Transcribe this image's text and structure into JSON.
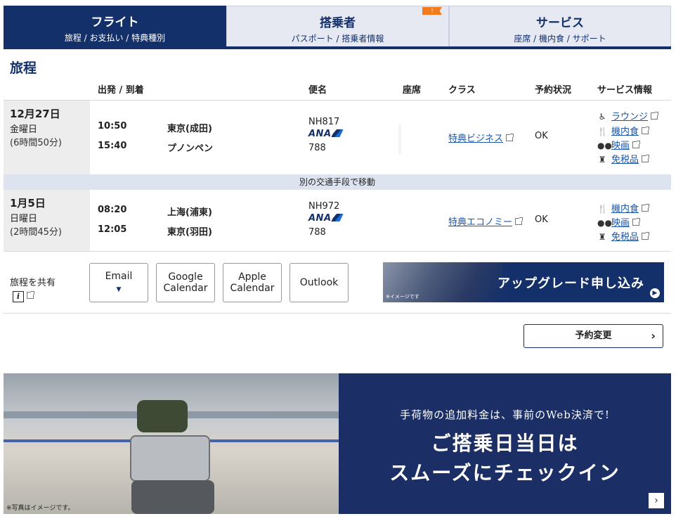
{
  "tabs": [
    {
      "title": "フライト",
      "sub": "旅程 / お支払い / 特典種別"
    },
    {
      "title": "搭乗者",
      "sub": "パスポート / 搭乗者情報"
    },
    {
      "title": "サービス",
      "sub": "座席 / 機内食 / サポート"
    }
  ],
  "section_title": "旅程",
  "headers": {
    "dep_arr": "出発 / 到着",
    "flight": "便名",
    "seat": "座席",
    "class": "クラス",
    "status": "予約状況",
    "service": "サービス情報"
  },
  "segments": [
    {
      "date": "12月27日",
      "weekday": "金曜日",
      "duration": "(6時間50分)",
      "dep_time": "10:50",
      "dep_city": "東京(成田)",
      "arr_time": "15:40",
      "arr_city": "プノンペン",
      "flight_no": "NH817",
      "airline": "ANA",
      "aircraft": "788",
      "class": "特典ビジネス",
      "status": "OK",
      "services": [
        {
          "icon": "lounge-icon",
          "label": "ラウンジ"
        },
        {
          "icon": "meal-icon",
          "label": "機内食"
        },
        {
          "icon": "movie-icon",
          "label": "映画"
        },
        {
          "icon": "duty-free-icon",
          "label": "免税品"
        }
      ]
    },
    {
      "date": "1月5日",
      "weekday": "日曜日",
      "duration": "(2時間45分)",
      "dep_time": "08:20",
      "dep_city": "上海(浦東)",
      "arr_time": "12:05",
      "arr_city": "東京(羽田)",
      "flight_no": "NH972",
      "airline": "ANA",
      "aircraft": "788",
      "class": "特典エコノミー",
      "status": "OK",
      "services": [
        {
          "icon": "meal-icon",
          "label": "機内食"
        },
        {
          "icon": "movie-icon",
          "label": "映画"
        },
        {
          "icon": "duty-free-icon",
          "label": "免税品"
        }
      ]
    }
  ],
  "transfer_note": "別の交通手段で移動",
  "share": {
    "label": "旅程を共有",
    "buttons": [
      {
        "line1": "Email",
        "line2": ""
      },
      {
        "line1": "Google",
        "line2": "Calendar"
      },
      {
        "line1": "Apple",
        "line2": "Calendar"
      },
      {
        "line1": "Outlook",
        "line2": ""
      }
    ]
  },
  "upgrade_banner": {
    "text": "アップグレード申し込み",
    "note": "※イメージです"
  },
  "change_button": "予約変更",
  "promo": {
    "line1": "手荷物の追加料金は、事前のWeb決済で!",
    "line2": "ご搭乗日当日は",
    "line3": "スムーズにチェックイン",
    "photo_note": "※写真はイメージです。"
  },
  "colors": {
    "brand": "#14306b",
    "link": "#1d56a7",
    "badge": "#f07a1c"
  }
}
